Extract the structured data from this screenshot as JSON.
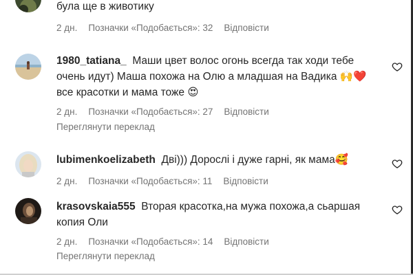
{
  "comments": [
    {
      "username": "",
      "text": "була ще в животику",
      "time": "2 дн.",
      "likes": "Позначки «Подобається»: 32",
      "reply": "Відповісти",
      "avatar_icon": "user-avatar-photo"
    },
    {
      "username": "1980_tatiana_",
      "text": "Маши цвет волос огонь всегда так ходи тебе очень идут) Маша похожа на Олю а младшая на Вадика 🙌❤️ все красотки и мама тоже 😍",
      "time": "2 дн.",
      "likes": "Позначки «Подобається»: 27",
      "reply": "Відповісти",
      "translate": "Переглянути переклад",
      "avatar_icon": "user-avatar-photo"
    },
    {
      "username": "lubimenkoelizabeth",
      "text": "Дві))) Дорослі і дуже гарні, як мама🥰",
      "time": "2 дн.",
      "likes": "Позначки «Подобається»: 11",
      "reply": "Відповісти",
      "avatar_icon": "user-avatar-photo"
    },
    {
      "username": "krasovskaia555",
      "text": "Вторая красотка,на мужа похожа,а сьаршая копия Оли",
      "time": "2 дн.",
      "likes": "Позначки «Подобається»: 14",
      "reply": "Відповісти",
      "translate": "Переглянути переклад",
      "avatar_icon": "user-avatar-photo"
    }
  ],
  "icons": {
    "like": "heart-outline-icon"
  },
  "colors": {
    "text": "#262626",
    "secondary": "#737373",
    "background": "#ffffff"
  }
}
